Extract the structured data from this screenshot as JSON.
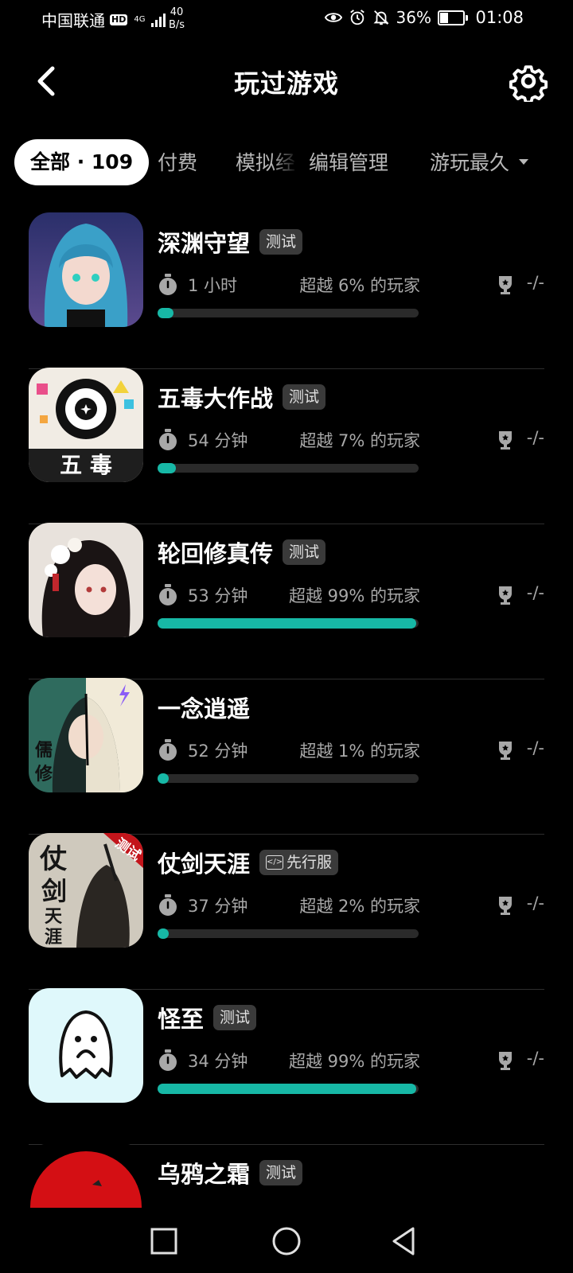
{
  "status_bar": {
    "carrier": "中国联通",
    "hd": "HD",
    "network_type": "4G",
    "net_speed_value": "40",
    "net_speed_unit": "B/s",
    "battery": "36%",
    "time": "01:08"
  },
  "header": {
    "title": "玩过游戏"
  },
  "tabs": [
    {
      "label": "全部 · 109"
    },
    {
      "label": "付费"
    },
    {
      "label": "模拟经"
    },
    {
      "label": "编辑管理"
    }
  ],
  "sort_label": "游玩最久",
  "games": [
    {
      "name": "深渊守望",
      "badge": "测试",
      "duration": "1 小时",
      "beat": "超越 6% 的玩家",
      "achievements": "-/-",
      "percentile": 6
    },
    {
      "name": "五毒大作战",
      "badge": "测试",
      "duration": "54 分钟",
      "beat": "超越 7% 的玩家",
      "achievements": "-/-",
      "percentile": 7,
      "thumb_text": "五 毒"
    },
    {
      "name": "轮回修真传",
      "badge": "测试",
      "duration": "53 分钟",
      "beat": "超越 99% 的玩家",
      "achievements": "-/-",
      "percentile": 99
    },
    {
      "name": "一念逍遥",
      "badge": "",
      "duration": "52 分钟",
      "beat": "超越 1% 的玩家",
      "achievements": "-/-",
      "percentile": 1,
      "thumb_text": "儒修"
    },
    {
      "name": "仗剑天涯",
      "badge": "先行服",
      "duration": "37 分钟",
      "beat": "超越 2% 的玩家",
      "achievements": "-/-",
      "percentile": 2,
      "thumb_text": "仗剑天涯",
      "thumb_tag": "测试"
    },
    {
      "name": "怪至",
      "badge": "测试",
      "duration": "34 分钟",
      "beat": "超越 99% 的玩家",
      "achievements": "-/-",
      "percentile": 99
    },
    {
      "name": "乌鸦之霜",
      "badge": "测试"
    }
  ],
  "colors": {
    "accent": "#17b8a6",
    "background": "#000000",
    "badge_bg": "#3a3a3a"
  }
}
